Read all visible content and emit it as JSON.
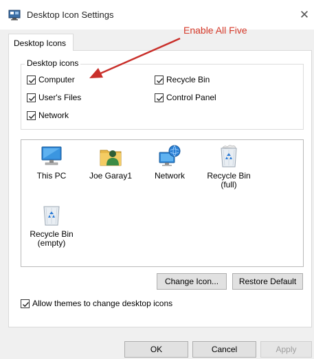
{
  "window": {
    "title": "Desktop Icon Settings",
    "close_glyph": "✕"
  },
  "tabs": [
    {
      "label": "Desktop Icons",
      "selected": true
    }
  ],
  "desktop_icons_group": {
    "label": "Desktop icons",
    "checkboxes": [
      {
        "label": "Computer",
        "checked": true
      },
      {
        "label": "User's Files",
        "checked": true
      },
      {
        "label": "Network",
        "checked": true
      },
      {
        "label": "Recycle Bin",
        "checked": true
      },
      {
        "label": "Control Panel",
        "checked": true
      }
    ]
  },
  "icon_list": [
    {
      "name": "This PC",
      "icon": "computer-icon"
    },
    {
      "name": "Joe Garay1",
      "icon": "user-folder-icon"
    },
    {
      "name": "Network",
      "icon": "network-icon"
    },
    {
      "name": "Recycle Bin\n(full)",
      "icon": "recycle-bin-full-icon"
    },
    {
      "name": "Recycle Bin\n(empty)",
      "icon": "recycle-bin-empty-icon"
    }
  ],
  "buttons": {
    "change_icon": "Change Icon...",
    "restore_default": "Restore Default",
    "ok": "OK",
    "cancel": "Cancel",
    "apply": "Apply"
  },
  "allow_themes": {
    "label": "Allow themes to change desktop icons",
    "checked": true
  },
  "annotation": {
    "text": "Enable All Five",
    "color": "#d63a2a"
  },
  "colors": {
    "dialog_bg": "#f0f0f0",
    "panel_bg": "#ffffff",
    "button_bg": "#e1e1e1",
    "annotation_red": "#d63a2a"
  }
}
